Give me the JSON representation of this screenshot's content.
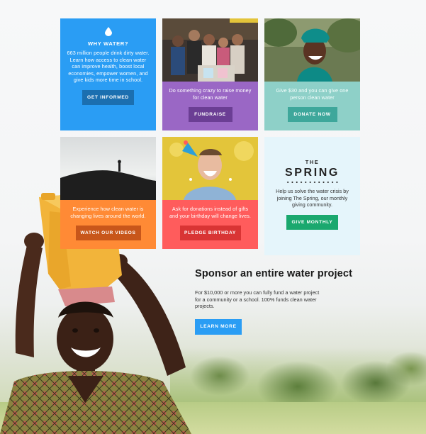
{
  "tiles": {
    "why_water": {
      "icon": "water-drop-icon",
      "heading": "WHY WATER?",
      "text": "663 million people drink dirty water. Learn how access to clean water can improve health, boost local economies, empower women, and give kids more time in school.",
      "button": "GET INFORMED",
      "color": "#2a9df4"
    },
    "fundraise": {
      "text": "Do something crazy to raise money for clean water",
      "button": "FUNDRAISE",
      "color": "#9a67c5"
    },
    "donate": {
      "text": "Give $30 and you can give one person clean water",
      "button": "DONATE NOW",
      "color": "#8ed0c8"
    },
    "videos": {
      "text": "Experience how clean water is changing lives around the world.",
      "button": "WATCH OUR VIDEOS",
      "color": "#ff8a35"
    },
    "birthday": {
      "text": "Ask for donations instead of gifts and your birthday will change lives.",
      "button": "PLEDGE BIRTHDAY",
      "color": "#ff5c5c"
    },
    "spring": {
      "the": "THE",
      "title": "SPRING",
      "text": "Help us solve the water crisis by joining The Spring, our monthly giving community.",
      "button": "GIVE MONTHLY",
      "color": "#1aa86e"
    }
  },
  "sponsor": {
    "title": "Sponsor an entire water project",
    "text": "For $10,000 or more you can fully fund a water project for a community or a school. 100% funds clean water projects.",
    "button": "LEARN MORE"
  }
}
